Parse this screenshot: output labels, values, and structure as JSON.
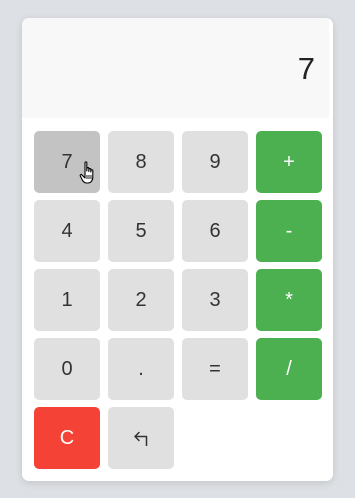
{
  "display": {
    "value": "7"
  },
  "keys": {
    "k7": "7",
    "k8": "8",
    "k9": "9",
    "plus": "+",
    "k4": "4",
    "k5": "5",
    "k6": "6",
    "minus": "-",
    "k1": "1",
    "k2": "2",
    "k3": "3",
    "multiply": "*",
    "k0": "0",
    "dot": ".",
    "equals": "=",
    "divide": "/",
    "clear": "C",
    "backspace_icon": "undo-arrow-icon"
  },
  "colors": {
    "operator": "#4caf50",
    "clear": "#f44336",
    "key": "#e0e0e0",
    "key_hover": "#c3c3c3",
    "display_bg": "#f8f8f8"
  },
  "state": {
    "hovered_key": "7",
    "cursor_icon": "hand-pointer-icon"
  }
}
